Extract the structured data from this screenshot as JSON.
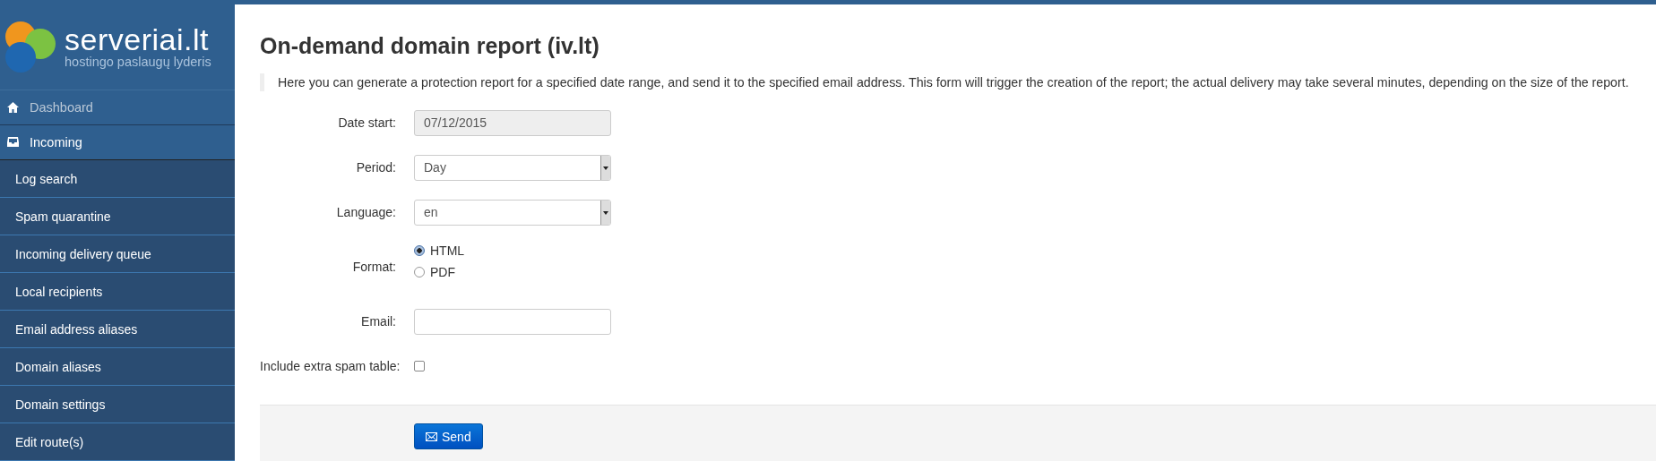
{
  "logo": {
    "name": "serveriai.lt",
    "tagline": "hostingo paslaugų lyderis"
  },
  "sidebar": {
    "items": [
      {
        "label": "Dashboard",
        "kind": "home",
        "selected": false
      },
      {
        "label": "Incoming",
        "kind": "inbox",
        "selected": true,
        "children": [
          {
            "label": "Log search"
          },
          {
            "label": "Spam quarantine"
          },
          {
            "label": "Incoming delivery queue"
          },
          {
            "label": "Local recipients"
          },
          {
            "label": "Email address aliases"
          },
          {
            "label": "Domain aliases"
          },
          {
            "label": "Domain settings"
          },
          {
            "label": "Edit route(s)"
          }
        ]
      }
    ]
  },
  "page": {
    "title": "On-demand domain report (iv.lt)",
    "description": "Here you can generate a protection report for a specified date range, and send it to the specified email address. This form will trigger the creation of the report; the actual delivery may take several minutes, depending on the size of the report."
  },
  "form": {
    "fields": [
      {
        "kind": "text",
        "label": "Date start:",
        "value": "07/12/2015",
        "disabled": true
      },
      {
        "kind": "select",
        "label": "Period:",
        "value": "Day"
      },
      {
        "kind": "select",
        "label": "Language:",
        "value": "en"
      },
      {
        "kind": "radio",
        "label": "Format:",
        "options": [
          {
            "label": "HTML",
            "selected": true
          },
          {
            "label": "PDF",
            "selected": false
          }
        ]
      },
      {
        "kind": "text",
        "label": "Email:",
        "disabled": false
      },
      {
        "kind": "checkbox",
        "label": "Include extra spam table:",
        "checked": false
      }
    ],
    "submit": "Send"
  }
}
